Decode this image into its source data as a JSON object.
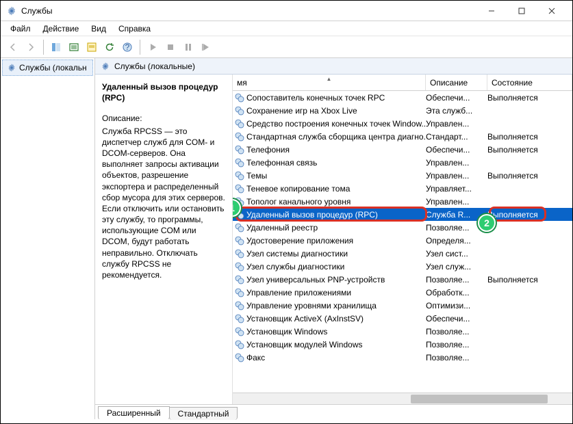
{
  "window": {
    "title": "Службы"
  },
  "menu": {
    "file": "Файл",
    "action": "Действие",
    "view": "Вид",
    "help": "Справка"
  },
  "left": {
    "root": "Службы (локальн"
  },
  "pane": {
    "title": "Службы (локальные)"
  },
  "detail": {
    "name": "Удаленный вызов процедур (RPC)",
    "desc_label": "Описание:",
    "desc": "Служба RPCSS — это диспетчер служб для COM- и DCOM-серверов. Она выполняет запросы активации объектов, разрешение экспортера и распределенный сбор мусора для этих серверов. Если отключить или остановить эту службу, то программы, использующие COM или DCOM, будут работать неправильно. Отключать службу RPCSS не рекомендуется."
  },
  "columns": {
    "name": "мя",
    "desc": "Описание",
    "state": "Состояние"
  },
  "rows": [
    {
      "n": "Сопоставитель конечных точек RPC",
      "d": "Обеспечи...",
      "s": "Выполняется"
    },
    {
      "n": "Сохранение игр на Xbox Live",
      "d": "Эта служб...",
      "s": ""
    },
    {
      "n": "Средство построения конечных точек Window...",
      "d": "Управлен...",
      "s": ""
    },
    {
      "n": "Стандартная служба сборщика центра диагно...",
      "d": "Стандарт...",
      "s": "Выполняется"
    },
    {
      "n": "Телефония",
      "d": "Обеспечи...",
      "s": "Выполняется"
    },
    {
      "n": "Телефонная связь",
      "d": "Управлен...",
      "s": ""
    },
    {
      "n": "Темы",
      "d": "Управлен...",
      "s": "Выполняется"
    },
    {
      "n": "Теневое копирование тома",
      "d": "Управляет...",
      "s": ""
    },
    {
      "n": "Тополог канального уровня",
      "d": "Управлен...",
      "s": ""
    },
    {
      "n": "Удаленный вызов процедур (RPC)",
      "d": "Служба R...",
      "s": "Выполняется",
      "sel": true
    },
    {
      "n": "Удаленный реестр",
      "d": "Позволяе...",
      "s": ""
    },
    {
      "n": "Удостоверение приложения",
      "d": "Определя...",
      "s": ""
    },
    {
      "n": "Узел системы диагностики",
      "d": "Узел сист...",
      "s": ""
    },
    {
      "n": "Узел службы диагностики",
      "d": "Узел служ...",
      "s": ""
    },
    {
      "n": "Узел универсальных PNP-устройств",
      "d": "Позволяе...",
      "s": "Выполняется"
    },
    {
      "n": "Управление приложениями",
      "d": "Обработк...",
      "s": ""
    },
    {
      "n": "Управление уровнями хранилища",
      "d": "Оптимизи...",
      "s": ""
    },
    {
      "n": "Установщик ActiveX (AxInstSV)",
      "d": "Обеспечи...",
      "s": ""
    },
    {
      "n": "Установщик Windows",
      "d": "Позволяе...",
      "s": ""
    },
    {
      "n": "Установщик модулей Windows",
      "d": "Позволяе...",
      "s": ""
    },
    {
      "n": "Факс",
      "d": "Позволяе...",
      "s": ""
    }
  ],
  "tabs": {
    "ext": "Расширенный",
    "std": "Стандартный"
  }
}
